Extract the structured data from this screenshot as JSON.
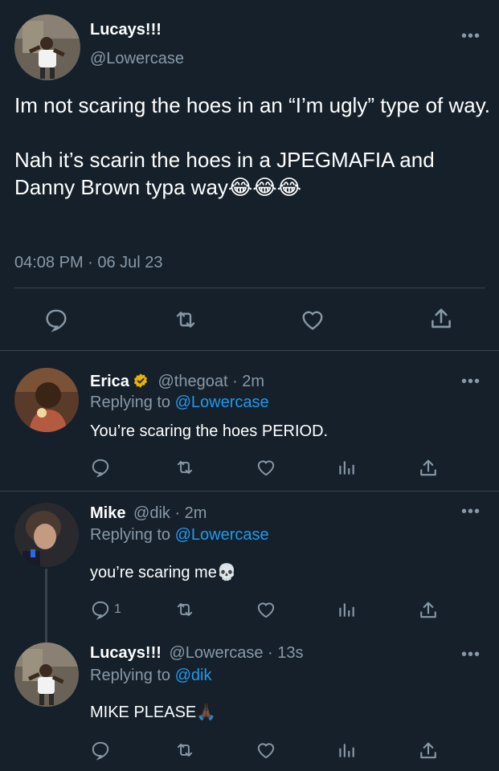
{
  "main_tweet": {
    "display_name": "Lucays!!!",
    "handle": "@Lowercase",
    "paragraph1": "Im not scaring the hoes in an “I’m ugly” type of way.",
    "paragraph2": "Nah it’s scarin the hoes in a JPEGMAFIA and Danny Brown typa way😂😂😂",
    "timestamp": "04:08 PM · 06 Jul 23",
    "more_label": "•••"
  },
  "replies": [
    {
      "display_name": "Erica",
      "verified": true,
      "handle_time": "@thegoat · 2m",
      "replying_prefix": "Replying to ",
      "replying_to": "@Lowercase",
      "text": "You’re scaring the hoes PERIOD.",
      "reply_count": ""
    },
    {
      "display_name": "Mike",
      "verified": false,
      "handle_time": "@dik · 2m",
      "replying_prefix": "Replying to ",
      "replying_to": "@Lowercase",
      "text": "you’re scaring me💀",
      "reply_count": "1"
    },
    {
      "display_name": "Lucays!!!",
      "verified": false,
      "handle_time": "@Lowercase · 13s",
      "replying_prefix": "Replying to ",
      "replying_to": "@dik",
      "text": "MIKE PLEASE🙏🏿",
      "reply_count": ""
    }
  ],
  "colors": {
    "background": "#15202b",
    "text": "#ffffff",
    "secondary": "#8899a6",
    "link": "#1d9bf0",
    "divider": "#38444d",
    "verified": "#e8b000"
  },
  "icons": [
    "reply-icon",
    "retweet-icon",
    "like-icon",
    "views-icon",
    "share-icon",
    "more-icon",
    "verified-badge-icon"
  ]
}
